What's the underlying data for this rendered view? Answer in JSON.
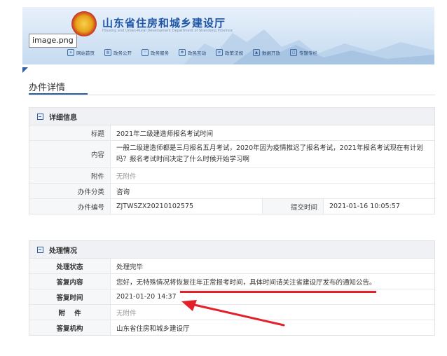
{
  "header": {
    "site_title": "山东省住房和城乡建设厅",
    "site_subtitle": "Housing and Urban-Rural Development Department of Shandong Province",
    "image_label": "image.png",
    "nav": [
      {
        "label": "网站首页",
        "icon": "home-icon"
      },
      {
        "label": "政务公开",
        "icon": "building-icon"
      },
      {
        "label": "政务服务",
        "icon": "service-icon"
      },
      {
        "label": "政民互动",
        "icon": "interaction-icon"
      },
      {
        "label": "政策法规",
        "icon": "document-icon"
      },
      {
        "label": "数据开放",
        "icon": "chart-icon"
      },
      {
        "label": "专题专栏",
        "icon": "topic-icon"
      }
    ]
  },
  "page_title": "办件详情",
  "detail": {
    "heading": "详细信息",
    "title_label": "标题",
    "title_value": "2021年二级建造师报名考试时间",
    "content_label": "内容",
    "content_value": "一般二级建造师都是三月报名五月考试，2020年因为疫情推迟了报名考试，2021年报名考试现在有计划吗？报名考试时间决定了什么时候开始学习啊",
    "attachment_label": "附件",
    "attachment_value": "无附件",
    "category_label": "办件分类",
    "category_value": "咨询",
    "number_label": "办件编号",
    "number_value": "ZJTWSZX20210102575",
    "submit_time_label": "提交时间",
    "submit_time_value": "2021-01-16 10:05:57"
  },
  "handling": {
    "heading": "处理情况",
    "status_label": "处理状态",
    "status_value": "处理完毕",
    "reply_content_label": "答复内容",
    "reply_content_value": "您好，无特殊情况将恢复往年正常报考时间，具体时间请关注省建设厅发布的通知公告。",
    "reply_time_label": "答复时间",
    "reply_time_value": "2021-01-20 14:37",
    "attachment_label": "附    件",
    "attachment_value": "无附件",
    "org_label": "答复机构",
    "org_value": "山东省住房和城乡建设厅"
  },
  "colors": {
    "brand_blue": "#2c5fa8",
    "annotation_red": "#e4202a",
    "header_bg": "#eff1f4"
  }
}
